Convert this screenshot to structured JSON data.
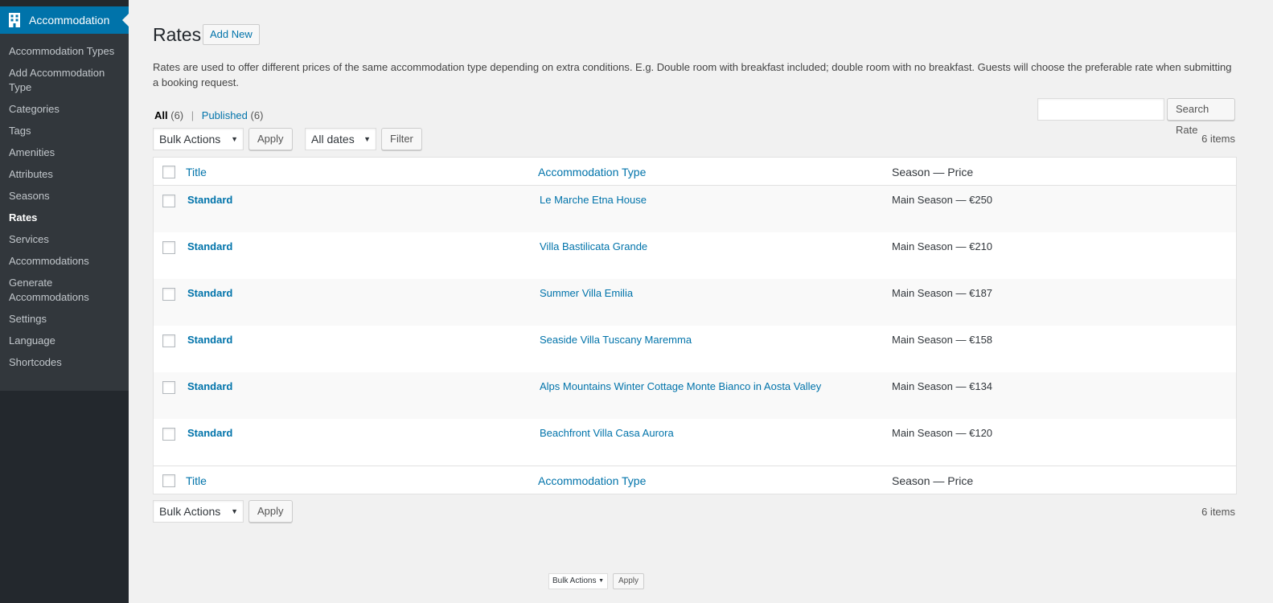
{
  "sidebar": {
    "head_label": "Accommodation",
    "items": [
      {
        "label": "Accommodation Types"
      },
      {
        "label": "Add Accommodation Type"
      },
      {
        "label": "Categories"
      },
      {
        "label": "Tags"
      },
      {
        "label": "Amenities"
      },
      {
        "label": "Attributes"
      },
      {
        "label": "Seasons"
      },
      {
        "label": "Rates",
        "current": true
      },
      {
        "label": "Services"
      },
      {
        "label": "Accommodations"
      },
      {
        "label": "Generate Accommodations"
      },
      {
        "label": "Settings"
      },
      {
        "label": "Language"
      },
      {
        "label": "Shortcodes"
      }
    ]
  },
  "header": {
    "title": "Rates",
    "add_new_label": "Add New",
    "description": "Rates are used to offer different prices of the same accommodation type depending on extra conditions. E.g. Double room with breakfast included; double room with no breakfast. Guests will choose the preferable rate when submitting a booking request."
  },
  "views": {
    "all_label": "All",
    "all_count": "(6)",
    "separator": "|",
    "published_label": "Published",
    "published_count": "(6)"
  },
  "search": {
    "button_label": "Search Rate"
  },
  "tablenav_top": {
    "bulk_actions": "Bulk Actions",
    "apply_label": "Apply",
    "dates": "All dates",
    "filter_label": "Filter",
    "items_count": "6 items"
  },
  "tablenav_bottom": {
    "bulk_actions": "Bulk Actions",
    "apply_label": "Apply",
    "items_count": "6 items"
  },
  "table": {
    "columns": {
      "title": "Title",
      "type": "Accommodation Type",
      "price": "Season — Price"
    },
    "rows": [
      {
        "title": "Standard",
        "type": "Le Marche Etna House",
        "price": "Main Season — €250"
      },
      {
        "title": "Standard",
        "type": "Villa Bastilicata Grande",
        "price": "Main Season — €210"
      },
      {
        "title": "Standard",
        "type": "Summer Villa Emilia",
        "price": "Main Season — €187"
      },
      {
        "title": "Standard",
        "type": "Seaside Villa Tuscany Maremma",
        "price": "Main Season — €158"
      },
      {
        "title": "Standard",
        "type": "Alps Mountains Winter Cottage Monte Bianco in Aosta Valley",
        "price": "Main Season — €134"
      },
      {
        "title": "Standard",
        "type": "Beachfront Villa Casa Aurora",
        "price": "Main Season — €120"
      }
    ]
  },
  "mini_actions": {
    "bulk_actions": "Bulk Actions",
    "apply_label": "Apply"
  },
  "colors": {
    "sidebar_bg": "#23282d",
    "submenu_bg": "#32373c",
    "accent": "#0073aa",
    "page_bg": "#f1f1f1"
  },
  "icons": {
    "menu_head": "building-icon"
  }
}
